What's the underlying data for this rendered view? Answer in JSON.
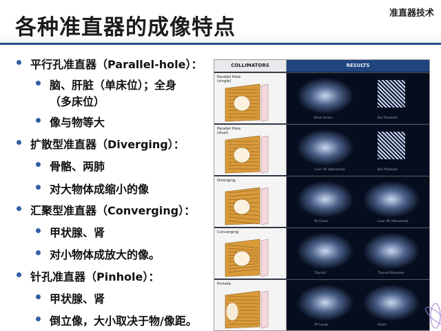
{
  "header": {
    "title": "各种准直器的成像特点",
    "brand": "准直器技术"
  },
  "bullets": [
    {
      "level": 1,
      "text": "平行孔准直器（Parallel-hole）："
    },
    {
      "level": 2,
      "text": "脑、肝脏（单床位）；全身"
    },
    {
      "level": 0,
      "text": "（多床位）"
    },
    {
      "level": 2,
      "text": "像与物等大"
    },
    {
      "level": 1,
      "text": "扩散型准直器（Diverging）："
    },
    {
      "level": 2,
      "text": "骨骼、两肺"
    },
    {
      "level": 2,
      "text": "对大物体成缩小的像"
    },
    {
      "level": 1,
      "text": "汇聚型准直器（Converging）："
    },
    {
      "level": 2,
      "text": "甲状腺、肾"
    },
    {
      "level": 2,
      "text": "对小物体成放大的像。"
    },
    {
      "level": 1,
      "text": "针孔准直器（Pinhole）："
    },
    {
      "level": 2,
      "text": "甲状腺、肾"
    },
    {
      "level": 2,
      "text": "倒立像，大小取决于物/像距。"
    }
  ],
  "figure": {
    "head_left": "COLLIMATORS",
    "head_right": "RESULTS",
    "rows": [
      {
        "label": "Parallel Hole\n(single)",
        "cap1": "Brain Scans",
        "cap2": "Bar Phantom"
      },
      {
        "label": "Parallel Hole\n(dual)",
        "cap1": "Liver AP (Abnormal)",
        "cap2": "Bar Phantom"
      },
      {
        "label": "Diverging",
        "cap1": "PA Chest",
        "cap2": "Liver PA (Abnormal)"
      },
      {
        "label": "Converging",
        "cap1": "Thyroid",
        "cap2": "Thyroid Phantom"
      },
      {
        "label": "Pinhole",
        "cap1": "AP Lungs",
        "cap2": "Heart"
      }
    ]
  },
  "colors": {
    "accent": "#2f5fa6",
    "rule": "#1f4e8c",
    "fig_head": "#21457f",
    "gold": "#d99b3a"
  }
}
